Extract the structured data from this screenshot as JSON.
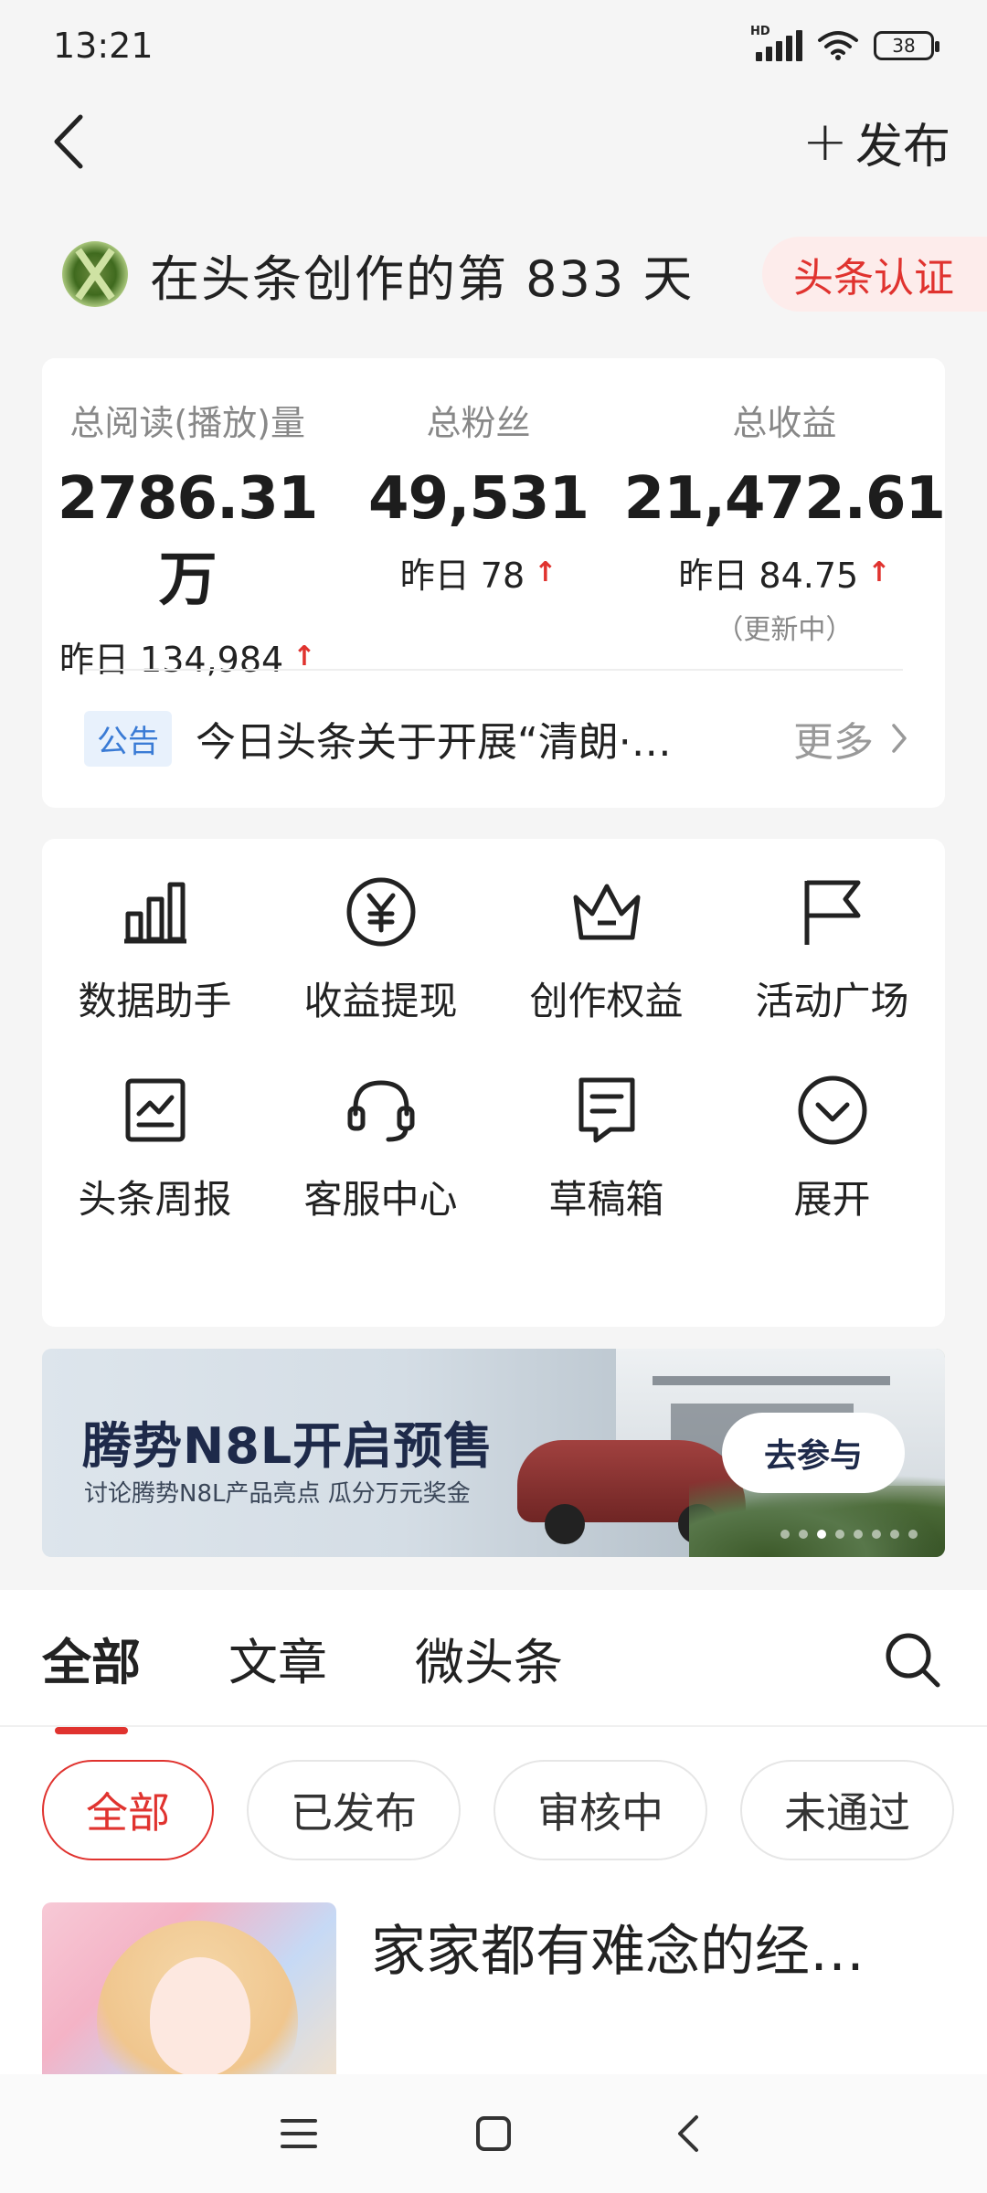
{
  "status_bar": {
    "time": "13:21",
    "network": "HD",
    "battery": "38"
  },
  "nav": {
    "publish_label": "发布"
  },
  "creator": {
    "text": "在头条创作的第 833 天",
    "badge": "头条认证"
  },
  "stats": [
    {
      "label": "总阅读(播放)量",
      "value": "2786.31万",
      "delta": "昨日 134,984",
      "note": ""
    },
    {
      "label": "总粉丝",
      "value": "49,531",
      "delta": "昨日 78",
      "note": ""
    },
    {
      "label": "总收益",
      "value": "21,472.61",
      "delta": "昨日 84.75",
      "note": "（更新中）"
    }
  ],
  "notice": {
    "tag": "公告",
    "text": "今日头条关于开展“清朗·…",
    "more": "更多"
  },
  "tools": [
    {
      "label": "数据助手",
      "icon": "bar-chart-icon"
    },
    {
      "label": "收益提现",
      "icon": "yuan-coin-icon"
    },
    {
      "label": "创作权益",
      "icon": "crown-icon"
    },
    {
      "label": "活动广场",
      "icon": "flag-icon"
    },
    {
      "label": "头条周报",
      "icon": "report-chart-icon"
    },
    {
      "label": "客服中心",
      "icon": "headset-icon"
    },
    {
      "label": "草稿箱",
      "icon": "draft-icon"
    },
    {
      "label": "展开",
      "icon": "expand-icon"
    }
  ],
  "banner": {
    "title": "腾势N8L开启预售",
    "subtitle": "讨论腾势N8L产品亮点 瓜分万元奖金",
    "cta": "去参与",
    "slide_count": 8,
    "active_slide": 3
  },
  "content_tabs": [
    "全部",
    "文章",
    "微头条"
  ],
  "filters": [
    "全部",
    "已发布",
    "审核中",
    "未通过"
  ],
  "article": {
    "title": "家家都有难念的经…"
  },
  "colors": {
    "accent": "#e0332f",
    "notice_blue": "#3a7bd5"
  }
}
